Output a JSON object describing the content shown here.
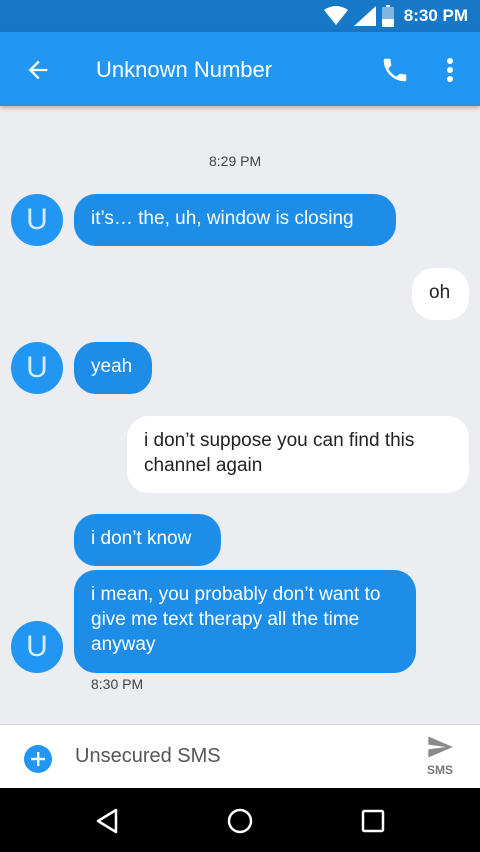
{
  "status_bar": {
    "time": "8:30 PM",
    "icons": [
      "wifi-icon",
      "cell-signal-icon",
      "battery-icon"
    ]
  },
  "header": {
    "title": "Unknown Number",
    "icons": [
      "back-arrow-icon",
      "phone-icon",
      "more-vert-icon"
    ]
  },
  "conversation": {
    "avatar_letter": "U",
    "timestamp_top": "8:29 PM",
    "messages": [
      {
        "direction": "in",
        "text": "it’s… the, uh, window is closing"
      },
      {
        "direction": "out",
        "text": "oh"
      },
      {
        "direction": "in",
        "text": "yeah"
      },
      {
        "direction": "out",
        "text": "i don’t suppose you can find this channel again"
      },
      {
        "direction": "in",
        "text": "i don’t know"
      },
      {
        "direction": "in",
        "text": "i mean, you probably don’t want to give me text therapy all the time anyway"
      }
    ],
    "timestamp_bottom": "8:30 PM"
  },
  "composer": {
    "placeholder": "Unsecured SMS",
    "send_label": "SMS"
  },
  "nav_bar": {
    "icons": [
      "back-triangle-icon",
      "home-circle-icon",
      "recents-square-icon"
    ]
  },
  "colors": {
    "status_bar": "#1778c8",
    "app_bar": "#2196f3",
    "incoming_bubble": "#1d8de8",
    "outgoing_bubble": "#ffffff",
    "background": "#ebedf0"
  }
}
